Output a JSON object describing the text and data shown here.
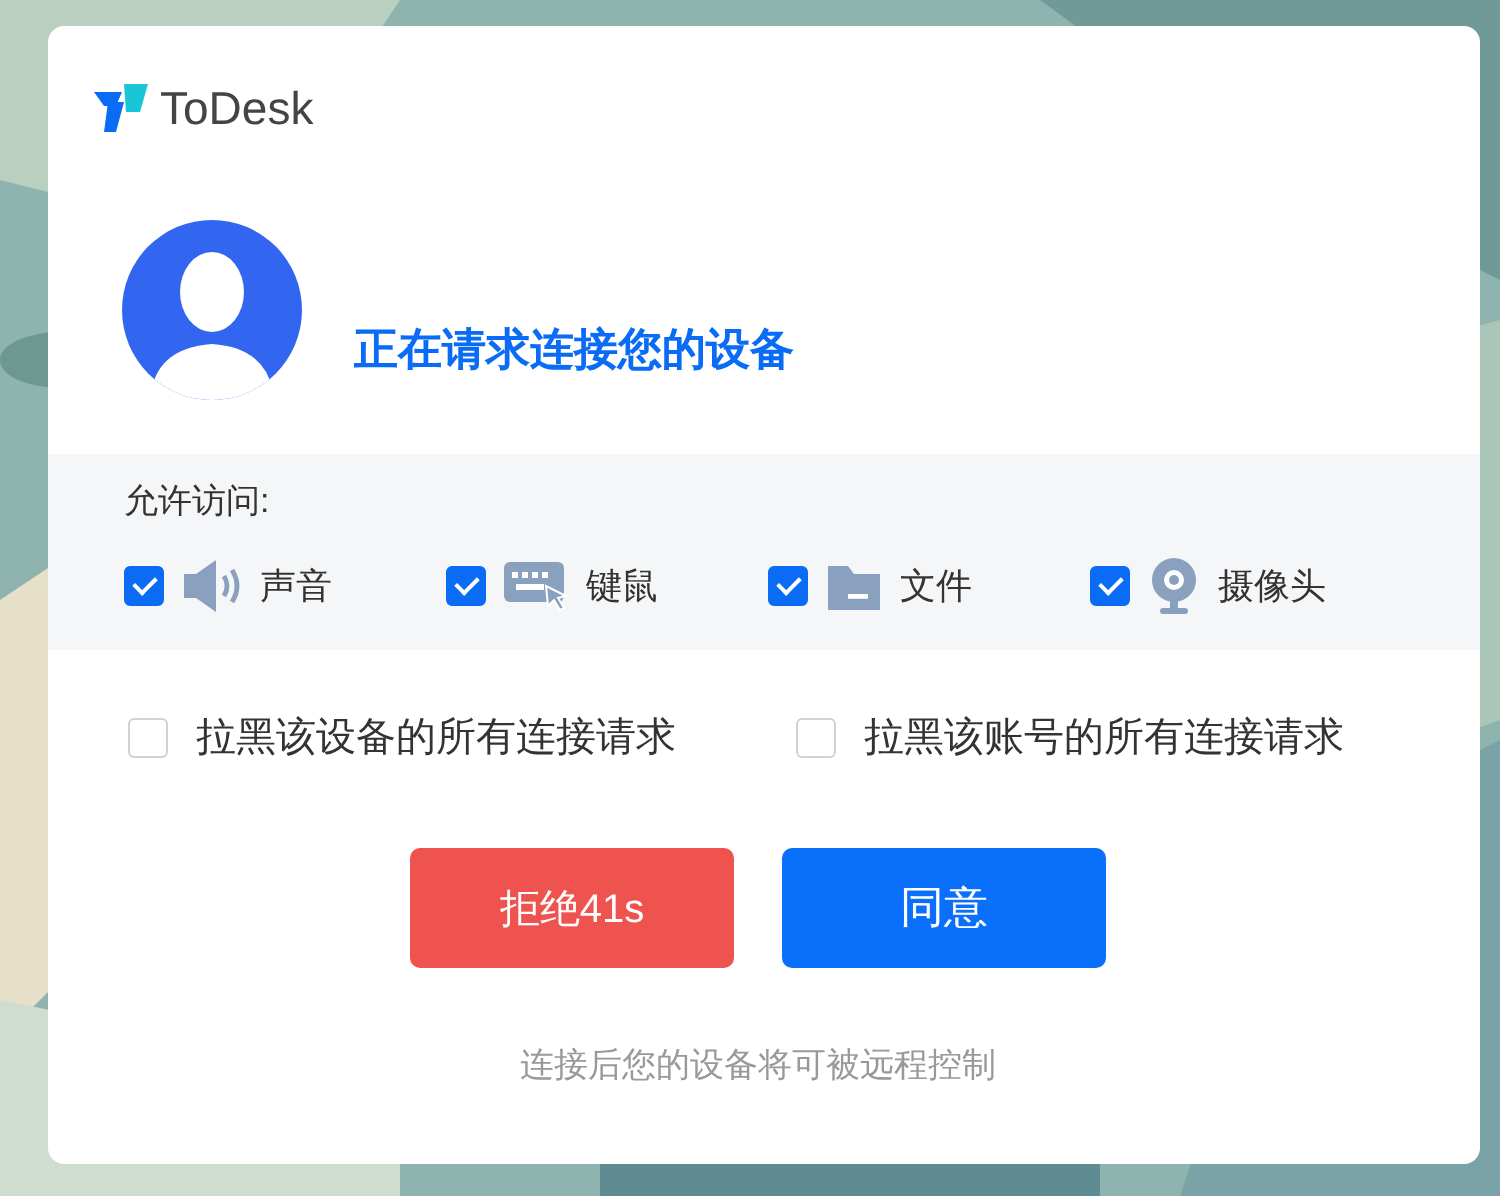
{
  "app": {
    "name": "ToDesk"
  },
  "request": {
    "title": "正在请求连接您的设备"
  },
  "permissions": {
    "label": "允许访问:",
    "items": [
      {
        "kind": "sound",
        "label": "声音",
        "checked": true
      },
      {
        "kind": "keyboard",
        "label": "键鼠",
        "checked": true
      },
      {
        "kind": "file",
        "label": "文件",
        "checked": true
      },
      {
        "kind": "camera",
        "label": "摄像头",
        "checked": true
      }
    ]
  },
  "blacklist": [
    {
      "label": "拉黑该设备的所有连接请求",
      "checked": false
    },
    {
      "label": "拉黑该账号的所有连接请求",
      "checked": false
    }
  ],
  "buttons": [
    {
      "kind": "reject",
      "label": "拒绝41s"
    },
    {
      "kind": "accept",
      "label": "同意"
    }
  ],
  "note": "连接后您的设备将可被远程控制"
}
